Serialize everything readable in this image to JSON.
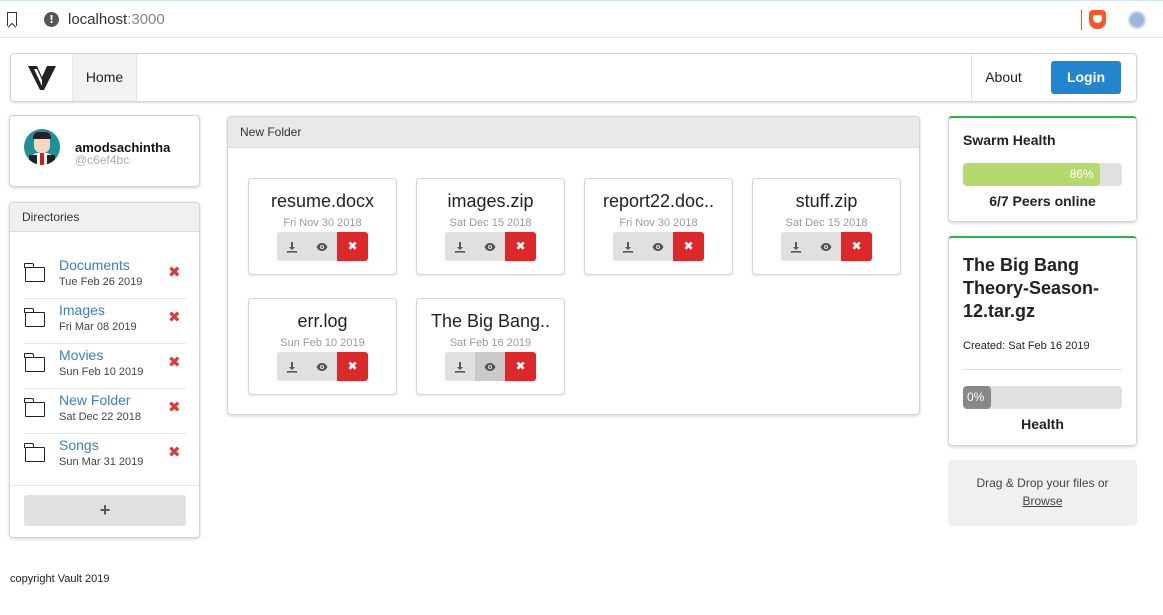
{
  "browser": {
    "url_host": "localhost",
    "url_port": ":3000"
  },
  "nav": {
    "home": "Home",
    "about": "About",
    "login": "Login"
  },
  "profile": {
    "username": "amodsachintha",
    "handle": "@c6ef4bc"
  },
  "directories": {
    "title": "Directories",
    "items": [
      {
        "name": "Documents",
        "date": "Tue Feb 26 2019"
      },
      {
        "name": "Images",
        "date": "Fri Mar 08 2019"
      },
      {
        "name": "Movies",
        "date": "Sun Feb 10 2019"
      },
      {
        "name": "New Folder",
        "date": "Sat Dec 22 2018"
      },
      {
        "name": "Songs",
        "date": "Sun Mar 31 2019"
      }
    ],
    "delete_glyph": "✖",
    "add_label": "+"
  },
  "folder": {
    "title": "New Folder",
    "files": [
      {
        "name": "resume.docx",
        "date": "Fri Nov 30 2018"
      },
      {
        "name": "images.zip",
        "date": "Sat Dec 15 2018"
      },
      {
        "name": "report22.doc..",
        "date": "Fri Nov 30 2018"
      },
      {
        "name": "stuff.zip",
        "date": "Sat Dec 15 2018"
      },
      {
        "name": "err.log",
        "date": "Sun Feb 10 2019"
      },
      {
        "name": "The Big Bang..",
        "date": "Sat Feb 16 2019"
      }
    ],
    "icons": [
      "download-icon",
      "eye-icon",
      "close-icon"
    ]
  },
  "swarm": {
    "title": "Swarm Health",
    "percent_label": "86%",
    "percent": 86,
    "peers": "6/7 Peers online"
  },
  "details": {
    "title": "The Big Bang Theory-Season-12.tar.gz",
    "created": "Created: Sat Feb 16 2019",
    "percent_label": "0%",
    "percent": 0,
    "health_label": "Health"
  },
  "dropzone": {
    "text": "Drag & Drop your files or",
    "browse": "Browse"
  },
  "footer": {
    "copyright": "copyright Vault 2019"
  },
  "colors": {
    "primary": "#2185d0",
    "danger": "#db2828",
    "link": "#3a7ec4",
    "success_border": "#21ba45",
    "swarm_fill": "#b5d96a"
  }
}
